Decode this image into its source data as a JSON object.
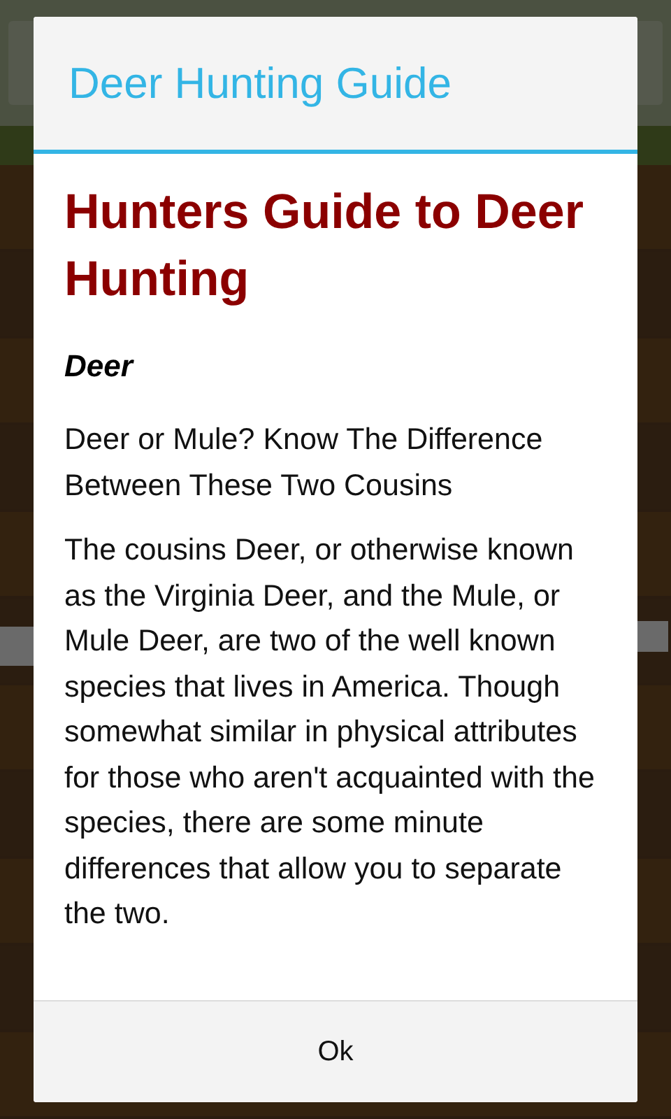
{
  "dialog": {
    "title": "Deer Hunting Guide",
    "heading": "Hunters Guide to Deer Hunting",
    "subheading": "Deer",
    "paragraphs": [
      "Deer or Mule? Know The Difference Between These Two Cousins",
      "The cousins Deer, or otherwise known as the Virginia Deer, and the Mule, or Mule Deer, are two of the well known species that lives in America. Though somewhat similar in physical attributes for those who aren't acquainted with the species, there are some minute differences that allow you to separate the two."
    ],
    "buttons": [
      "Ok"
    ]
  }
}
